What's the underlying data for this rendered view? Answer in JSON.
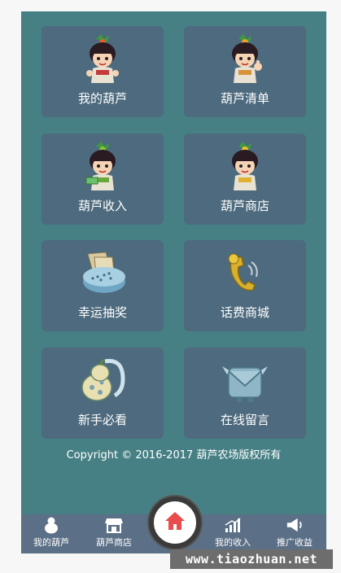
{
  "tiles": [
    {
      "label": "我的葫芦",
      "icon": "calabash-boy-icon"
    },
    {
      "label": "葫芦清单",
      "icon": "calabash-boy-thumbs-up-icon"
    },
    {
      "label": "葫芦收入",
      "icon": "calabash-boy-money-icon"
    },
    {
      "label": "葫芦商店",
      "icon": "calabash-boy-shop-icon"
    },
    {
      "label": "幸运抽奖",
      "icon": "lottery-box-icon"
    },
    {
      "label": "话费商城",
      "icon": "telephone-handset-icon"
    },
    {
      "label": "新手必看",
      "icon": "gourd-guide-icon"
    },
    {
      "label": "在线留言",
      "icon": "envelope-monster-icon"
    }
  ],
  "footer": {
    "copyright": "Copyright © 2016-2017 葫芦农场版权所有"
  },
  "tabbar": {
    "items": [
      {
        "label": "我的葫芦",
        "icon": "gourd-icon"
      },
      {
        "label": "葫芦商店",
        "icon": "store-icon"
      },
      {
        "label": "我的收入",
        "icon": "bar-chart-icon"
      },
      {
        "label": "推广收益",
        "icon": "megaphone-icon"
      }
    ],
    "home_icon": "home-icon"
  },
  "watermark": "www.tiaozhuan.net",
  "colors": {
    "background": "#468084",
    "tile": "#4d6a7e",
    "tabbar": "#5b6f86",
    "home_accent": "#e84c4c"
  }
}
